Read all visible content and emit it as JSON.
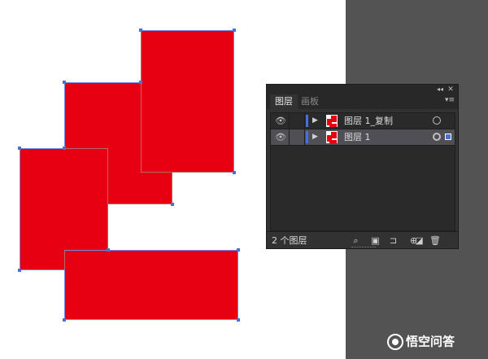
{
  "panel": {
    "collapse_glyph": "◂◂",
    "close_glyph": "✕",
    "menu_glyph": "▾≡",
    "tabs": [
      {
        "label": "图层",
        "active": true
      },
      {
        "label": "画板",
        "active": false
      }
    ],
    "layers": [
      {
        "name": "图层 1_复制",
        "visible": true,
        "selected": false,
        "color": "#4a6fd8"
      },
      {
        "name": "图层 1",
        "visible": true,
        "selected": true,
        "color": "#4a6fd8"
      }
    ],
    "layer_count": "2 个图层",
    "bottom_icons": [
      "search-icon",
      "collect-export-icon",
      "make-clipping-mask-icon",
      "new-sublayer-icon",
      "new-layer-icon",
      "delete-icon"
    ]
  },
  "artwork": {
    "fill_color": "#e60012",
    "shape_count": 4
  },
  "watermark": {
    "text": "悟空问答"
  }
}
